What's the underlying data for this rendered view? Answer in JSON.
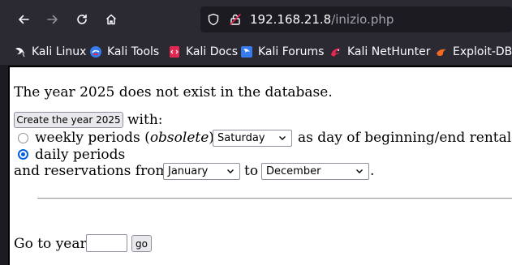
{
  "browser": {
    "url_host": "192.168.21.8",
    "url_path": "/inizio.php",
    "bookmarks": [
      "Kali Linux",
      "Kali Tools",
      "Kali Docs",
      "Kali Forums",
      "Kali NetHunter",
      "Exploit-DB"
    ]
  },
  "page": {
    "message": "The year 2025 does not exist in the database.",
    "create_button": "Create the year 2025",
    "with_text": "with:",
    "weekly_label_before": "weekly periods (",
    "weekly_label_obsolete": "obsolete",
    "weekly_label_after": "):",
    "weekly_day_select": "Saturday",
    "weekly_day_suffix": "as day of beginning/end rental",
    "daily_label": "daily periods",
    "reservations_from": "and reservations from",
    "from_month": "January",
    "to_text": "to",
    "to_month": "December",
    "period": ".",
    "goto_label": "Go to year",
    "goto_input_value": "",
    "go_button": "go"
  },
  "colors": {
    "browser_chrome": "#2b2a33",
    "radio_accent": "#0060df"
  }
}
